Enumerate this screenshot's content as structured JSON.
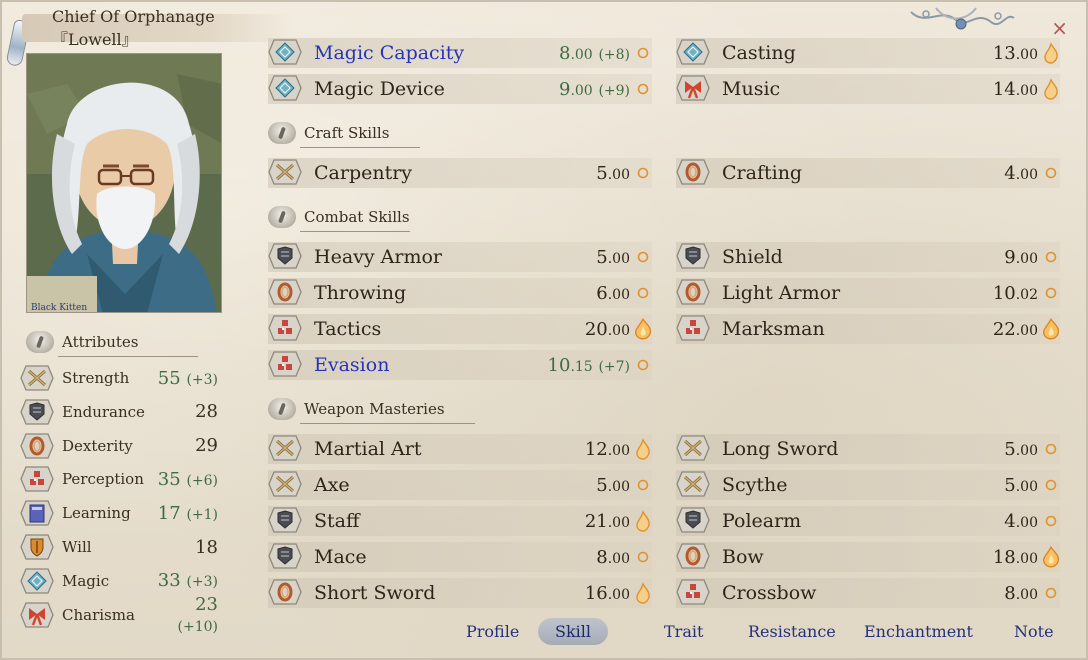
{
  "window": {
    "title": "Chief Of Orphanage『Lowell』",
    "close_label": "×"
  },
  "portrait": {
    "caption": "Black Kitten"
  },
  "attributes": {
    "heading": "Attributes",
    "items": [
      {
        "name": "Strength",
        "value": "55",
        "bonus": "(+3)",
        "icon": "crossed-swords-icon",
        "boosted": true
      },
      {
        "name": "Endurance",
        "value": "28",
        "bonus": "",
        "icon": "armor-icon",
        "boosted": false
      },
      {
        "name": "Dexterity",
        "value": "29",
        "bonus": "",
        "icon": "rope-ring-icon",
        "boosted": false
      },
      {
        "name": "Perception",
        "value": "35",
        "bonus": "(+6)",
        "icon": "dots-grid-icon",
        "boosted": true
      },
      {
        "name": "Learning",
        "value": "17",
        "bonus": "(+1)",
        "icon": "book-icon",
        "boosted": true
      },
      {
        "name": "Will",
        "value": "18",
        "bonus": "",
        "icon": "shield-crest-icon",
        "boosted": false
      },
      {
        "name": "Magic",
        "value": "33",
        "bonus": "(+3)",
        "icon": "magic-diamond-icon",
        "boosted": true
      },
      {
        "name": "Charisma",
        "value": "23",
        "bonus": "(+10)",
        "icon": "ribbon-icon",
        "boosted": true
      }
    ]
  },
  "skills": {
    "top": [
      {
        "name": "Magic Capacity",
        "int": "8",
        "dec": ".00",
        "bonus": "(+8)",
        "icon": "magic-diamond-icon",
        "potential": "small",
        "highlight": true
      },
      {
        "name": "Casting",
        "int": "13",
        "dec": ".00",
        "bonus": "",
        "icon": "magic-diamond-icon",
        "potential": "flame",
        "highlight": false
      },
      {
        "name": "Magic Device",
        "int": "9",
        "dec": ".00",
        "bonus": "(+9)",
        "icon": "magic-diamond-icon",
        "potential": "small",
        "highlight": false
      },
      {
        "name": "Music",
        "int": "14",
        "dec": ".00",
        "bonus": "",
        "icon": "ribbon-icon",
        "potential": "flame",
        "highlight": false
      }
    ],
    "craft": {
      "heading": "Craft Skills",
      "items": [
        {
          "name": "Carpentry",
          "int": "5",
          "dec": ".00",
          "bonus": "",
          "icon": "crossed-swords-icon",
          "potential": "small"
        },
        {
          "name": "Crafting",
          "int": "4",
          "dec": ".00",
          "bonus": "",
          "icon": "rope-ring-icon",
          "potential": "small"
        }
      ]
    },
    "combat": {
      "heading": "Combat Skills",
      "items": [
        {
          "name": "Heavy Armor",
          "int": "5",
          "dec": ".00",
          "bonus": "",
          "icon": "armor-icon",
          "potential": "small"
        },
        {
          "name": "Shield",
          "int": "9",
          "dec": ".00",
          "bonus": "",
          "icon": "armor-icon",
          "potential": "small"
        },
        {
          "name": "Throwing",
          "int": "6",
          "dec": ".00",
          "bonus": "",
          "icon": "rope-ring-icon",
          "potential": "small"
        },
        {
          "name": "Light Armor",
          "int": "10",
          "dec": ".02",
          "bonus": "",
          "icon": "rope-ring-icon",
          "potential": "small"
        },
        {
          "name": "Tactics",
          "int": "20",
          "dec": ".00",
          "bonus": "",
          "icon": "dots-grid-icon",
          "potential": "big-flame"
        },
        {
          "name": "Marksman",
          "int": "22",
          "dec": ".00",
          "bonus": "",
          "icon": "dots-grid-icon",
          "potential": "big-flame"
        },
        {
          "name": "Evasion",
          "int": "10",
          "dec": ".15",
          "bonus": "(+7)",
          "icon": "dots-grid-icon",
          "potential": "small",
          "highlight": true
        }
      ]
    },
    "weapon": {
      "heading": "Weapon Masteries",
      "items": [
        {
          "name": "Martial Art",
          "int": "12",
          "dec": ".00",
          "bonus": "",
          "icon": "crossed-swords-icon",
          "potential": "flame"
        },
        {
          "name": "Long Sword",
          "int": "5",
          "dec": ".00",
          "bonus": "",
          "icon": "crossed-swords-icon",
          "potential": "small"
        },
        {
          "name": "Axe",
          "int": "5",
          "dec": ".00",
          "bonus": "",
          "icon": "crossed-swords-icon",
          "potential": "small"
        },
        {
          "name": "Scythe",
          "int": "5",
          "dec": ".00",
          "bonus": "",
          "icon": "crossed-swords-icon",
          "potential": "small"
        },
        {
          "name": "Staff",
          "int": "21",
          "dec": ".00",
          "bonus": "",
          "icon": "armor-icon",
          "potential": "flame"
        },
        {
          "name": "Polearm",
          "int": "4",
          "dec": ".00",
          "bonus": "",
          "icon": "armor-icon",
          "potential": "small"
        },
        {
          "name": "Mace",
          "int": "8",
          "dec": ".00",
          "bonus": "",
          "icon": "armor-icon",
          "potential": "small"
        },
        {
          "name": "Bow",
          "int": "18",
          "dec": ".00",
          "bonus": "",
          "icon": "rope-ring-icon",
          "potential": "big-flame"
        },
        {
          "name": "Short Sword",
          "int": "16",
          "dec": ".00",
          "bonus": "",
          "icon": "rope-ring-icon",
          "potential": "flame"
        },
        {
          "name": "Crossbow",
          "int": "8",
          "dec": ".00",
          "bonus": "",
          "icon": "dots-grid-icon",
          "potential": "small"
        }
      ]
    }
  },
  "tabs": [
    {
      "label": "Profile",
      "active": false
    },
    {
      "label": "Skill",
      "active": true
    },
    {
      "label": "Trait",
      "active": false
    },
    {
      "label": "Resistance",
      "active": false
    },
    {
      "label": "Enchantment",
      "active": false
    },
    {
      "label": "Note",
      "active": false
    }
  ],
  "colors": {
    "highlight_text": "#2633b8",
    "bonus_green": "#3e6b43",
    "tab_text": "#23317a",
    "close": "#b2565a"
  }
}
